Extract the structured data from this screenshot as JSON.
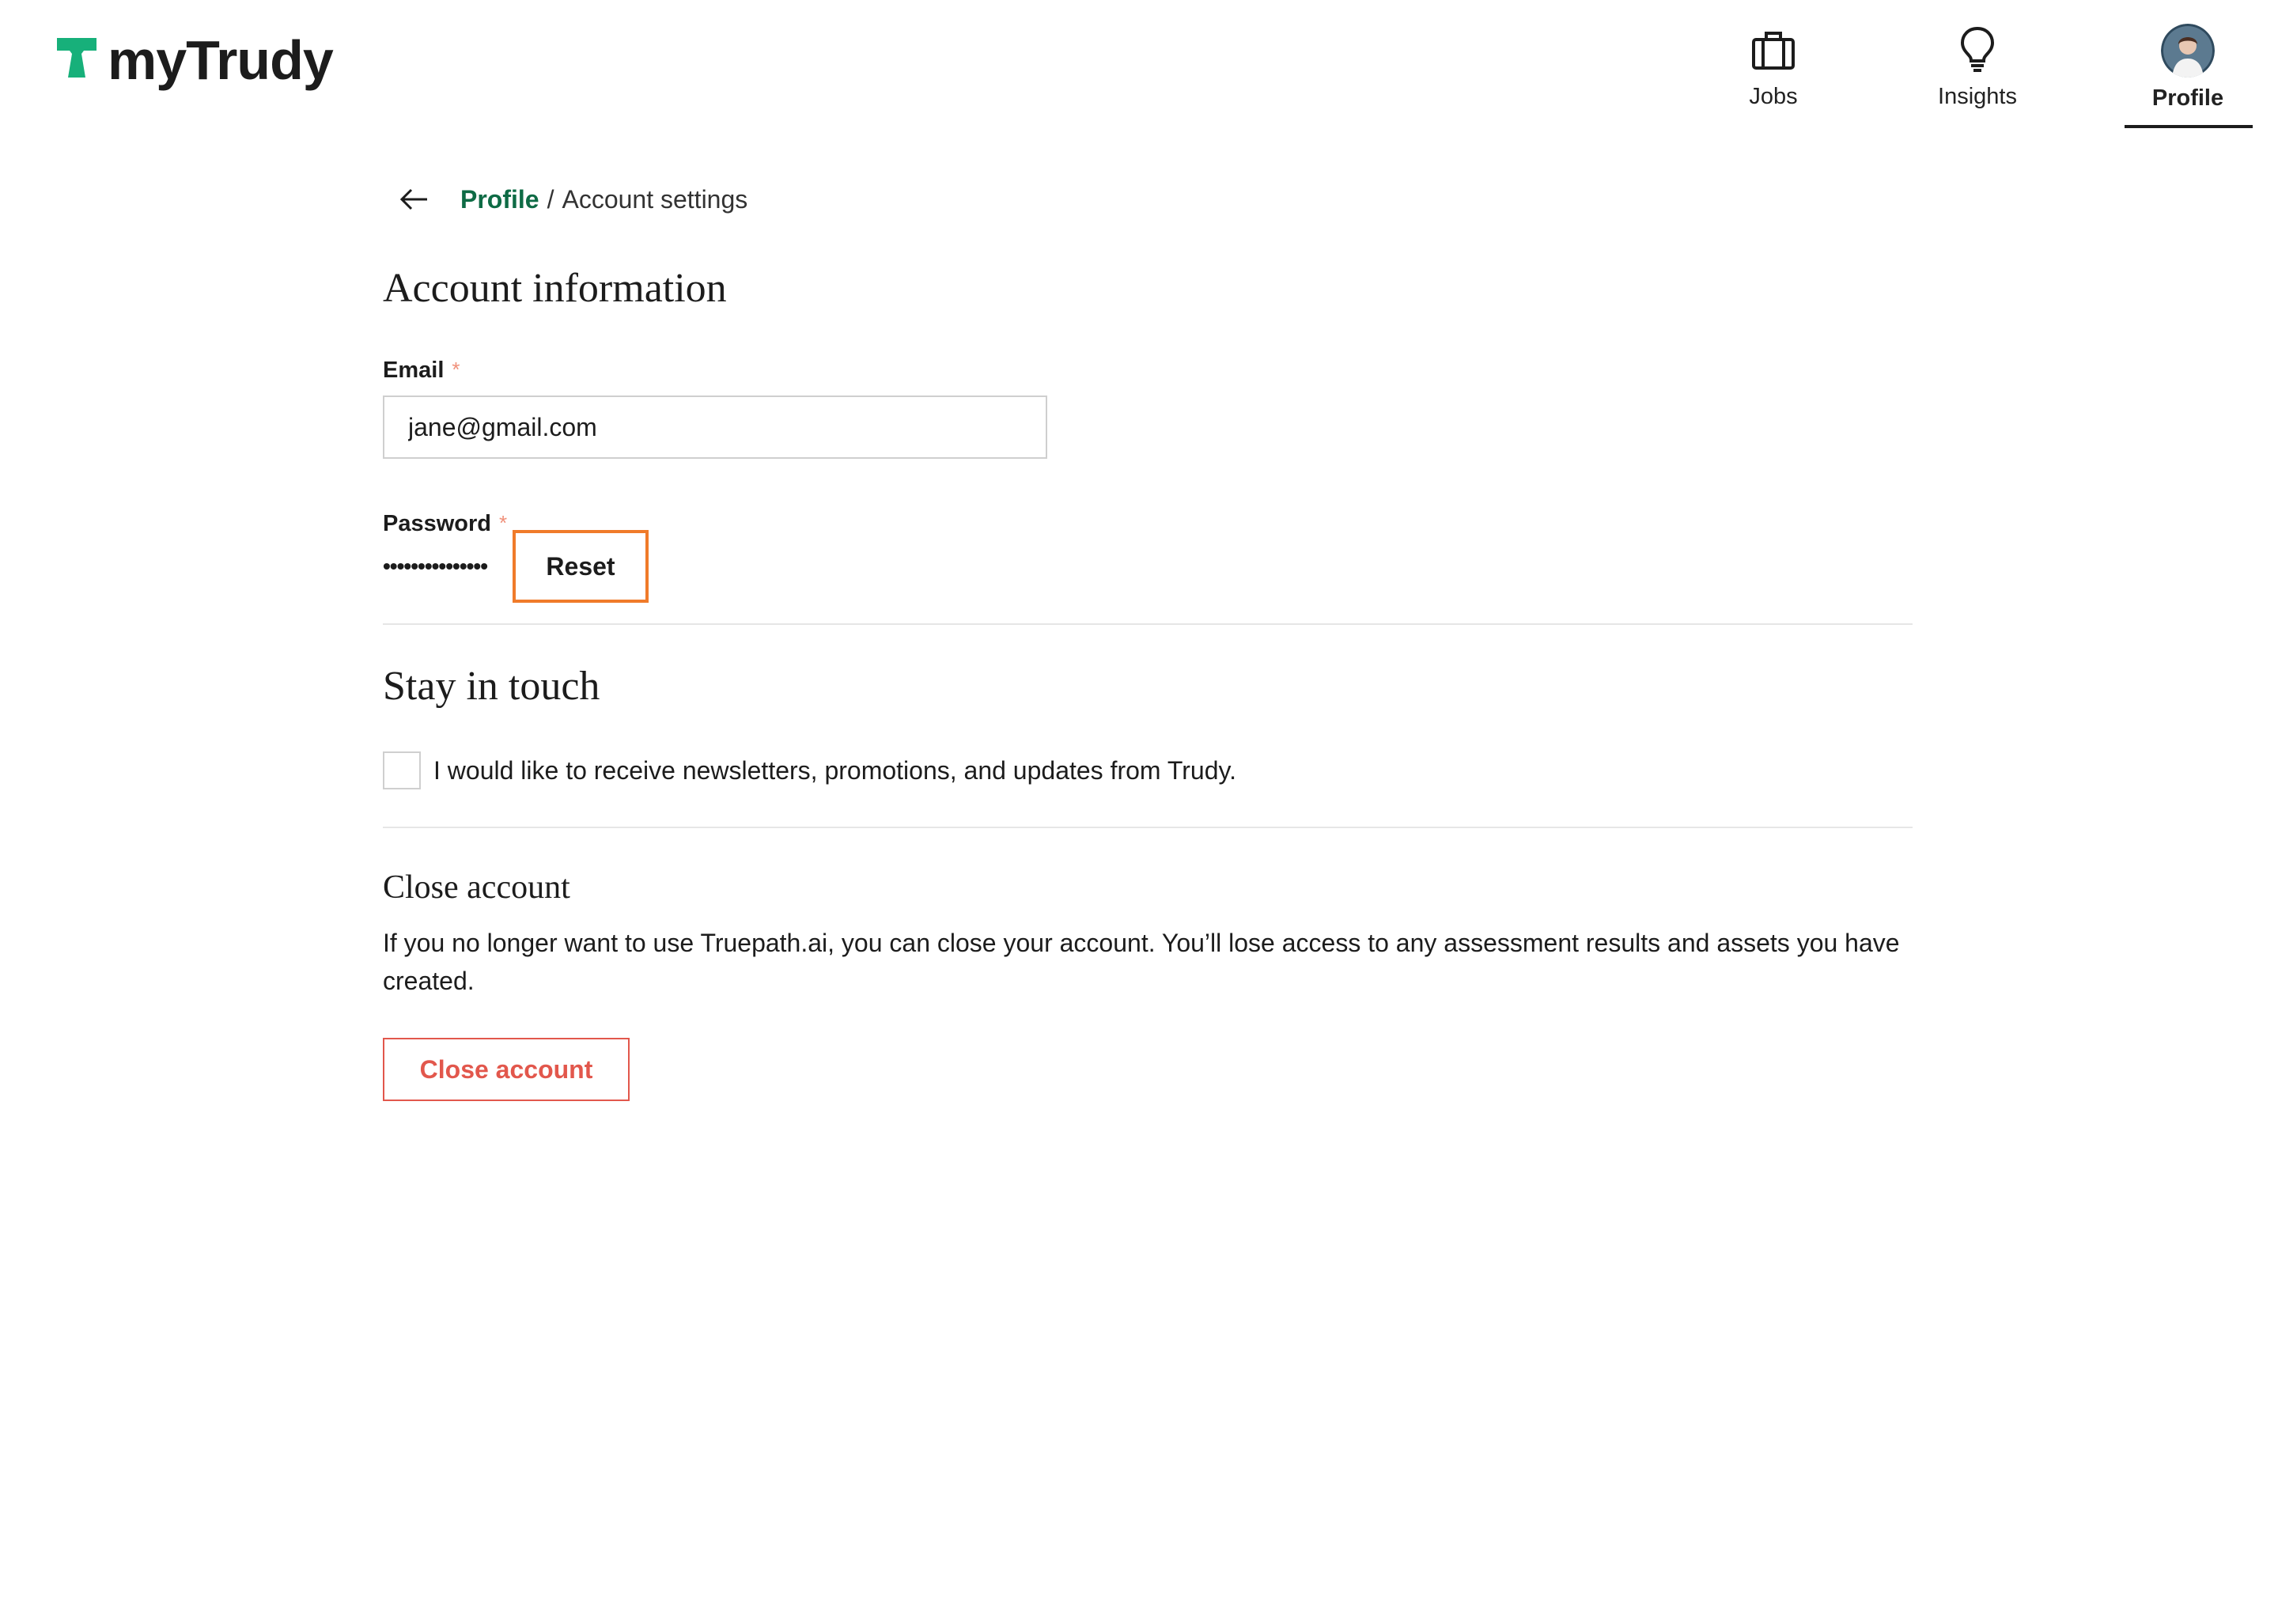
{
  "app": {
    "logo_text": "myTrudy",
    "brand_color": "#17b07a"
  },
  "nav": {
    "items": [
      {
        "label": "Jobs",
        "icon": "briefcase-icon"
      },
      {
        "label": "Insights",
        "icon": "lightbulb-icon"
      },
      {
        "label": "Profile",
        "icon": "avatar",
        "active": true
      }
    ]
  },
  "breadcrumb": {
    "parent": "Profile",
    "separator": "/",
    "current": "Account settings"
  },
  "account_info": {
    "title": "Account information",
    "email_label": "Email",
    "email_value": "jane@gmail.com",
    "required_mark": "*",
    "password_label": "Password",
    "password_masked": "•••••••••••••••",
    "reset_label": "Reset"
  },
  "stay_in_touch": {
    "title": "Stay in touch",
    "checkbox_label": "I would like to receive newsletters, promotions, and updates from Trudy.",
    "checked": false
  },
  "close_account": {
    "title": "Close account",
    "description": "If you no longer want to use Truepath.ai, you can close your account. You’ll lose access to any assessment results and assets you have created.",
    "button_label": "Close account"
  },
  "colors": {
    "link_green": "#0e6b45",
    "danger": "#e2574c",
    "focus_orange": "#f07b2a",
    "required": "#f0907a"
  }
}
